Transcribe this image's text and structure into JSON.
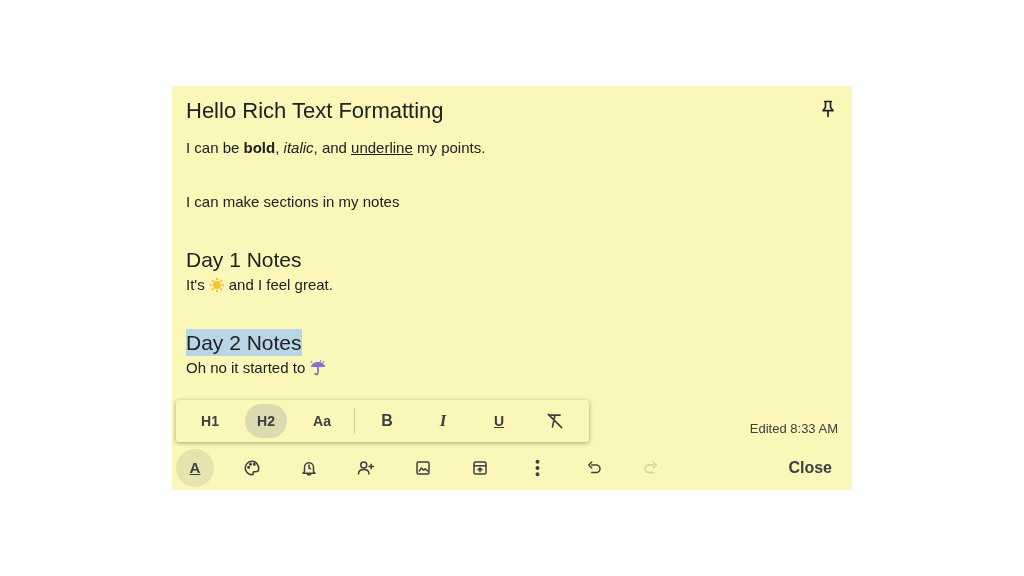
{
  "note": {
    "title": "Hello Rich Text Formatting",
    "pinned": false,
    "blocks": [
      {
        "kind": "text",
        "runs": [
          {
            "kind": "plain",
            "text": "I can be "
          },
          {
            "kind": "bold",
            "text": "bold"
          },
          {
            "kind": "plain",
            "text": ", "
          },
          {
            "kind": "italic",
            "text": "italic"
          },
          {
            "kind": "plain",
            "text": ", and "
          },
          {
            "kind": "underline",
            "text": "underline"
          },
          {
            "kind": "plain",
            "text": " my points."
          }
        ]
      },
      {
        "kind": "blank"
      },
      {
        "kind": "text",
        "runs": [
          {
            "kind": "plain",
            "text": "I can make sections in my notes"
          }
        ]
      },
      {
        "kind": "blank"
      },
      {
        "kind": "heading",
        "selected": false,
        "runs": [
          {
            "kind": "plain",
            "text": "Day 1 Notes"
          }
        ]
      },
      {
        "kind": "text",
        "runs": [
          {
            "kind": "plain",
            "text": "It's"
          },
          {
            "kind": "sun"
          },
          {
            "kind": "plain",
            "text": "and I feel great."
          }
        ]
      },
      {
        "kind": "blank"
      },
      {
        "kind": "heading",
        "selected": true,
        "runs": [
          {
            "kind": "plain",
            "text": "Day 2 Notes"
          }
        ]
      },
      {
        "kind": "text",
        "runs": [
          {
            "kind": "plain",
            "text": "Oh no it started to"
          },
          {
            "kind": "rain"
          }
        ]
      }
    ]
  },
  "format_toolbar": [
    {
      "kind": "heading",
      "label": "H1",
      "hovered": false
    },
    {
      "kind": "heading",
      "label": "H2",
      "hovered": true
    },
    {
      "kind": "heading",
      "label": "Aa",
      "hovered": false
    },
    {
      "kind": "divider"
    },
    {
      "kind": "bold",
      "label": "B",
      "hovered": false
    },
    {
      "kind": "italic",
      "label": "I",
      "hovered": false
    },
    {
      "kind": "underline",
      "label": "U",
      "hovered": false
    },
    {
      "kind": "clear",
      "hovered": false
    }
  ],
  "edited": "Edited 8:33 AM",
  "bottom_toolbar": [
    {
      "kind": "format",
      "label": "A",
      "active": true,
      "disabled": false
    },
    {
      "kind": "palette",
      "active": false,
      "disabled": false
    },
    {
      "kind": "reminder",
      "active": false,
      "disabled": false
    },
    {
      "kind": "collaborator",
      "active": false,
      "disabled": false
    },
    {
      "kind": "image",
      "active": false,
      "disabled": false
    },
    {
      "kind": "archive",
      "active": false,
      "disabled": false
    },
    {
      "kind": "more",
      "active": false,
      "disabled": false
    },
    {
      "kind": "undo",
      "active": false,
      "disabled": false
    },
    {
      "kind": "redo",
      "active": false,
      "disabled": true
    }
  ],
  "close": "Close"
}
